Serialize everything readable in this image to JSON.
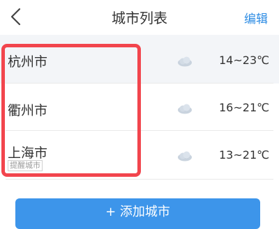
{
  "header": {
    "title": "城市列表",
    "edit_label": "编辑",
    "back_icon": "chevron-left-icon"
  },
  "cities": [
    {
      "name": "杭州市",
      "weather_icon": "cloud-icon",
      "temp": "14~23℃"
    },
    {
      "name": "衢州市",
      "weather_icon": "cloud-icon",
      "temp": "16~21℃"
    },
    {
      "name": "上海市",
      "weather_icon": "cloud-icon",
      "temp": "13~21℃",
      "tag": "提醒城市"
    }
  ],
  "add_button": {
    "label": "+ 添加城市"
  },
  "colors": {
    "accent": "#3d95ea",
    "edit_link": "#2f8de4",
    "highlight_border": "#f2454d",
    "selected_row_bg": "#f3f5f8"
  }
}
